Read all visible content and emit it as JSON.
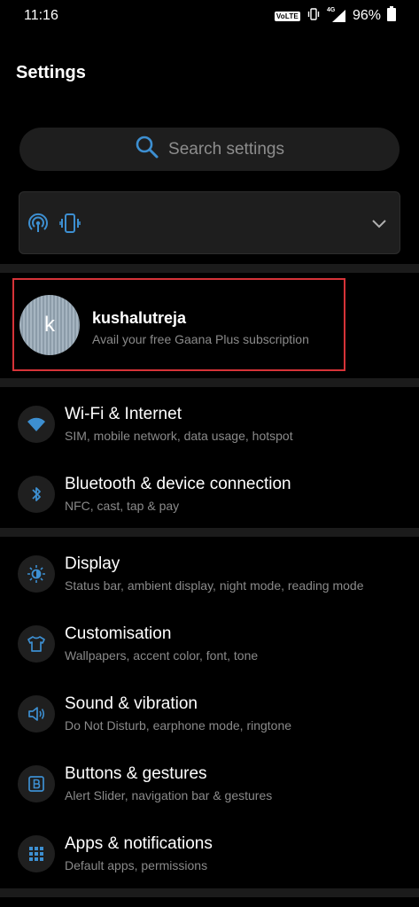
{
  "status_bar": {
    "time": "11:16",
    "volte": "VoLTE",
    "network": "4G",
    "battery": "96%"
  },
  "page": {
    "title": "Settings"
  },
  "search": {
    "placeholder": "Search settings"
  },
  "profile": {
    "initial": "k",
    "name": "kushalutreja",
    "subtitle": "Avail your free Gaana Plus subscription"
  },
  "sections": [
    {
      "items": [
        {
          "title": "Wi-Fi & Internet",
          "subtitle": "SIM, mobile network, data usage, hotspot",
          "icon": "wifi-icon"
        },
        {
          "title": "Bluetooth & device connection",
          "subtitle": "NFC, cast, tap & pay",
          "icon": "bluetooth-icon"
        }
      ]
    },
    {
      "items": [
        {
          "title": "Display",
          "subtitle": "Status bar, ambient display, night mode, reading mode",
          "icon": "brightness-icon"
        },
        {
          "title": "Customisation",
          "subtitle": "Wallpapers, accent color, font, tone",
          "icon": "tshirt-icon"
        },
        {
          "title": "Sound & vibration",
          "subtitle": "Do Not Disturb, earphone mode, ringtone",
          "icon": "speaker-icon"
        },
        {
          "title": "Buttons & gestures",
          "subtitle": "Alert Slider, navigation bar & gestures",
          "icon": "button-b-icon"
        },
        {
          "title": "Apps & notifications",
          "subtitle": "Default apps, permissions",
          "icon": "apps-grid-icon"
        }
      ]
    }
  ],
  "colors": {
    "accent": "#3d8fd1",
    "background": "#000000",
    "card": "#1e1e1e",
    "highlight_border": "#d63338"
  }
}
